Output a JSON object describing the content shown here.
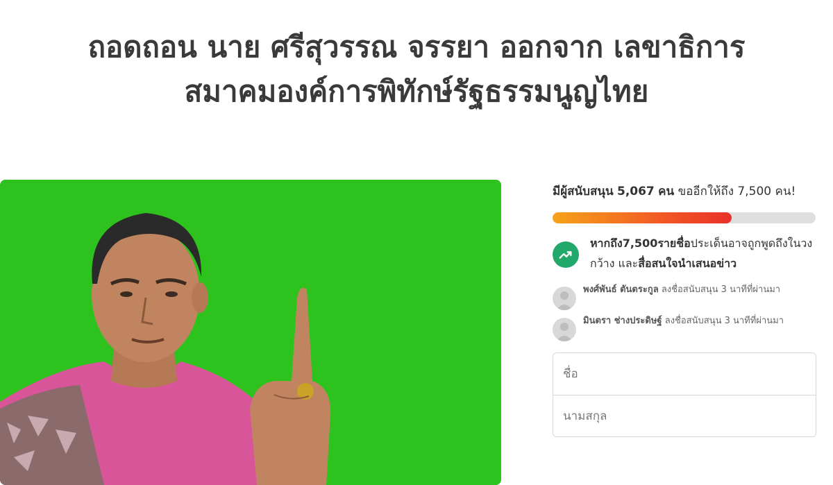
{
  "title": {
    "line1": "ถอดถอน นาย ศรีสุวรรณ จรรยา ออกจาก เลขาธิการ",
    "line2": "สมาคมองค์การพิทักษ์รัฐธรรมนูญไทย"
  },
  "support": {
    "prefix": "มีผู้สนับสนุน",
    "count": "5,067",
    "unit": "คน",
    "suffix": "ขออีกให้ถึง 7,500 คน!",
    "progress_percent": 68
  },
  "goal": {
    "icon": "trending-up-icon",
    "text_bold_1": "หากถึง7,500รายชื่อ",
    "text_regular": "ประเด็นอาจถูกพูดถึงในวงกว้าง และ",
    "text_bold_2": "สื่อสนใจนำเสนอข่าว"
  },
  "recent_signers": [
    {
      "name": "พงศ์พันธ์ ตันตระกูล",
      "action": "ลงชื่อสนับสนุน 3 นาทีที่ผ่านมา"
    },
    {
      "name": "มินตรา ช่างประดิษฐ์",
      "action": "ลงชื่อสนับสนุน 3 นาทีที่ผ่านมา"
    }
  ],
  "form": {
    "first_name_placeholder": "ชื่อ",
    "last_name_placeholder": "นามสกุล"
  },
  "colors": {
    "photo_background": "#2ec21f",
    "progress_start": "#f7a21b",
    "progress_end": "#e8312a",
    "goal_icon": "#21a86a"
  }
}
